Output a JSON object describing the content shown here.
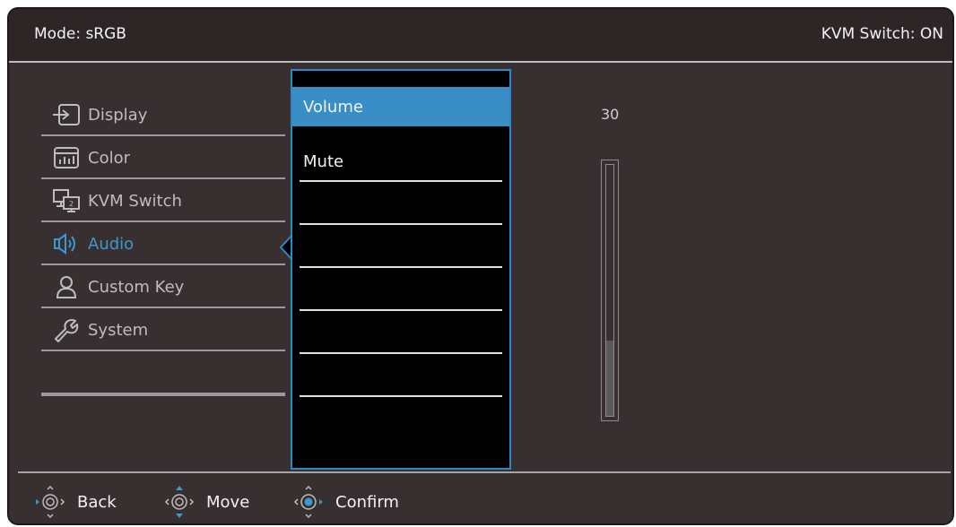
{
  "header": {
    "mode": "Mode: sRGB",
    "kvm_status": "KVM Switch: ON"
  },
  "colors": {
    "accent": "#3a8ec6",
    "background": "#383030",
    "submenu_bg": "#000000"
  },
  "main_menu": {
    "items": [
      {
        "label": "Display",
        "icon": "display-input-icon",
        "active": false
      },
      {
        "label": "Color",
        "icon": "color-icon",
        "active": false
      },
      {
        "label": "KVM Switch",
        "icon": "kvm-switch-icon",
        "active": false
      },
      {
        "label": "Audio",
        "icon": "audio-speaker-icon",
        "active": true
      },
      {
        "label": "Custom Key",
        "icon": "person-icon",
        "active": false
      },
      {
        "label": "System",
        "icon": "wrench-icon",
        "active": false
      }
    ]
  },
  "submenu": {
    "items": [
      {
        "label": "Volume",
        "selected": true
      },
      {
        "label": "Mute",
        "selected": false
      },
      {
        "label": ""
      },
      {
        "label": ""
      },
      {
        "label": ""
      },
      {
        "label": ""
      },
      {
        "label": ""
      }
    ]
  },
  "volume": {
    "value": "30",
    "level_fraction": 0.3
  },
  "footer": {
    "back": "Back",
    "move": "Move",
    "confirm": "Confirm"
  }
}
